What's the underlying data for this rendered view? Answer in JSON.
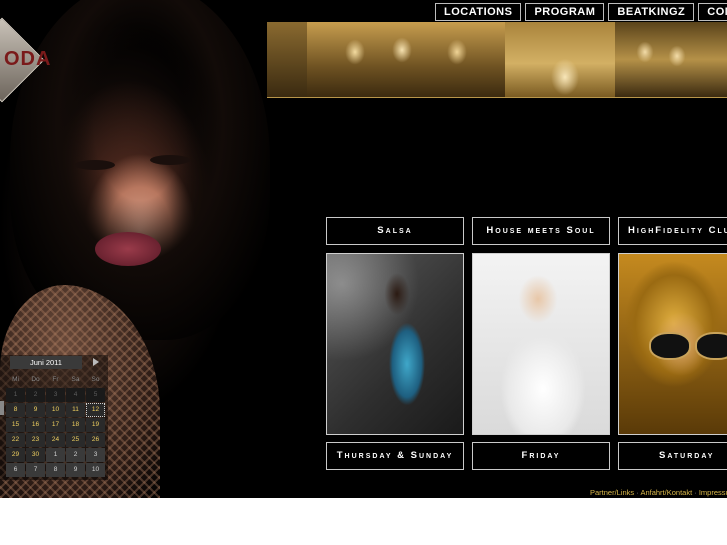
{
  "brand": {
    "logo_text": "ODA"
  },
  "nav": {
    "items": [
      "LOCATIONS",
      "PROGRAM",
      "BEATKINGZ",
      "COMMUNITY"
    ]
  },
  "events": [
    {
      "genre": "Salsa",
      "day": "Thursday & Sunday"
    },
    {
      "genre": "House meets Soul",
      "day": "Friday"
    },
    {
      "genre": "HighFidelity Club",
      "day": "Saturday"
    }
  ],
  "calendar": {
    "title": "Juni 2011",
    "weekdays": [
      "Mi",
      "Do",
      "Fr",
      "Sa",
      "So"
    ],
    "rows": [
      [
        "1",
        "2",
        "3",
        "4",
        "5"
      ],
      [
        "8",
        "9",
        "10",
        "11",
        "12"
      ],
      [
        "15",
        "16",
        "17",
        "18",
        "19"
      ],
      [
        "22",
        "23",
        "24",
        "25",
        "26"
      ],
      [
        "29",
        "30",
        "1",
        "2",
        "3"
      ],
      [
        "6",
        "7",
        "8",
        "9",
        "10"
      ]
    ]
  },
  "footer": {
    "links": [
      "Partner/Links",
      "Anfahrt/Kontakt",
      "Impressum"
    ],
    "separator": "·"
  },
  "colors": {
    "background": "#000000",
    "calendar_active_text": "#f0d060",
    "footer_link": "#d9b84a"
  }
}
